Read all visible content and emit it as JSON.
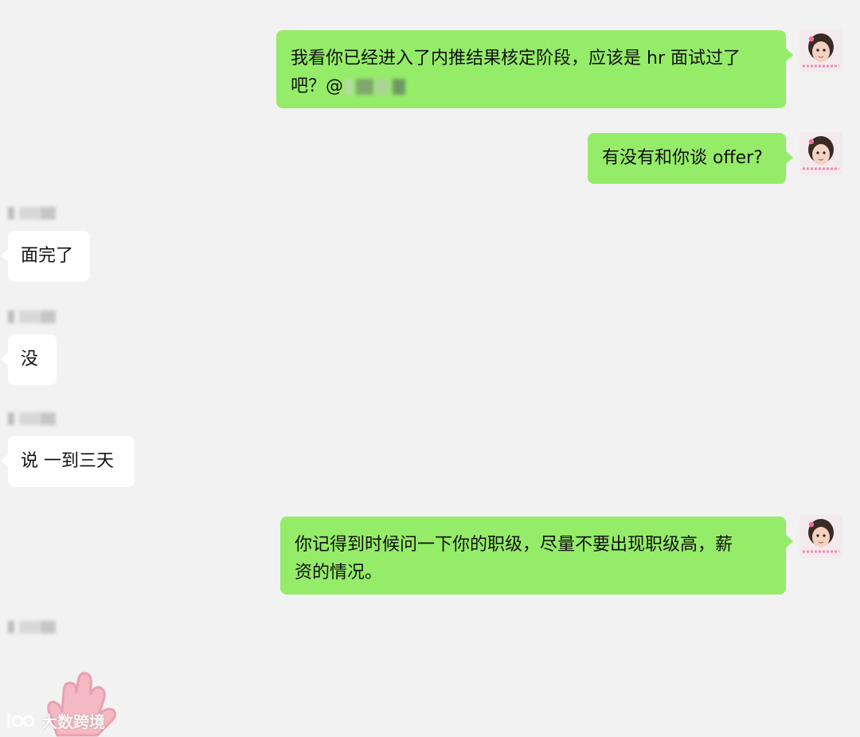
{
  "chat": {
    "messages": [
      {
        "side": "out",
        "text_line1": "我看你已经进入了内推结果核定阶段，应该是 hr 面试过了",
        "text_line2": "吧？@"
      },
      {
        "side": "out",
        "text": "有没有和你谈 offer?"
      },
      {
        "side": "in",
        "text": "面完了"
      },
      {
        "side": "in",
        "text": "没"
      },
      {
        "side": "in",
        "text": "说 一到三天"
      },
      {
        "side": "out",
        "text_line1": "你记得到时候问一下你的职级，尽量不要出现职级高，薪",
        "text_line2": "资的情况。"
      }
    ]
  },
  "watermark": {
    "text": "大数跨境"
  },
  "colors": {
    "background": "#f2f2f2",
    "outgoing_bubble": "#95ec69",
    "incoming_bubble": "#ffffff"
  },
  "icons": {
    "avatar": "girl-photo-avatar",
    "watermark_logo": "brand-logo-icon",
    "hand": "hand-sticker-icon"
  }
}
